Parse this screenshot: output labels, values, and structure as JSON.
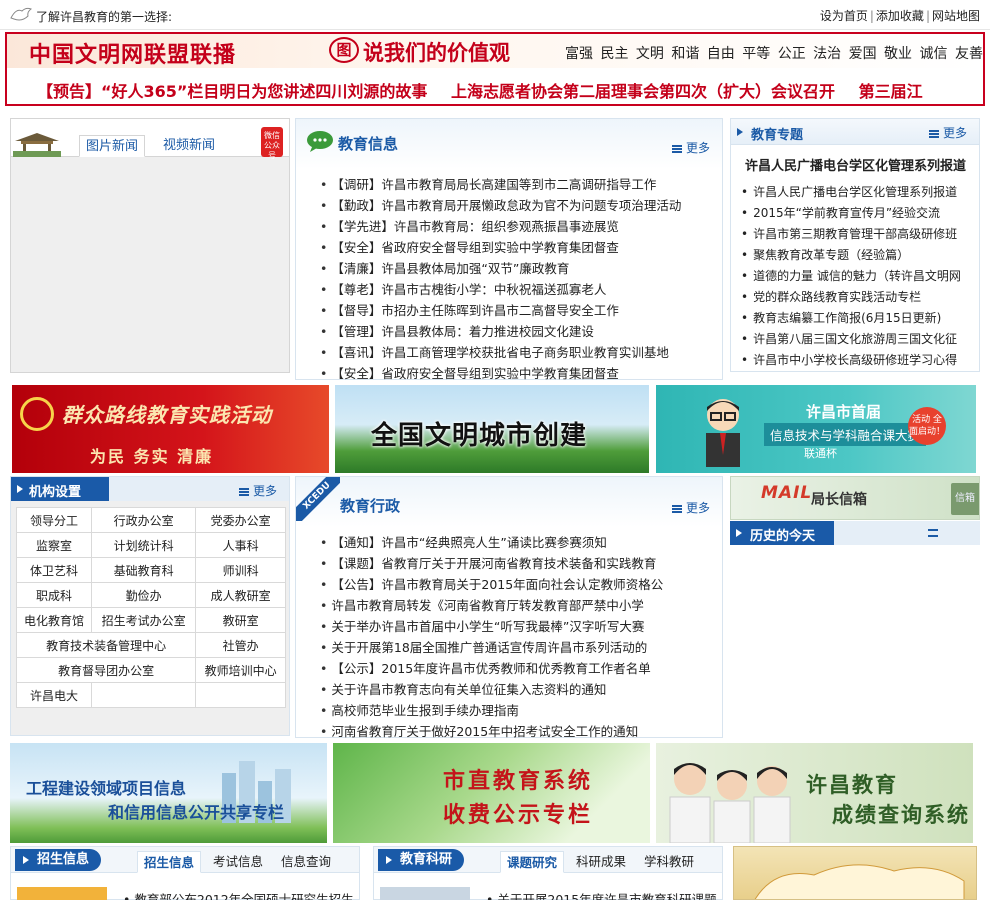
{
  "topbar": {
    "slogan": "了解许昌教育的第一选择:",
    "links": [
      "设为首页",
      "添加收藏",
      "网站地图"
    ]
  },
  "civ_banner": {
    "brand": "中国文明网联盟联播",
    "tu": "图",
    "shuo": "说我们的价值观",
    "values": "富强 民主 文明 和谐 自由 平等 公正 法治 爱国 敬业 诚信 友善",
    "marquee": [
      "【预告】“好人365”栏目明日为您讲述四川刘源的故事",
      "上海志愿者协会第二届理事会第四次（扩大）会议召开",
      "第三届江"
    ]
  },
  "photo_news": {
    "tabs": [
      "图片新闻",
      "视频新闻"
    ],
    "badge": "微信 公众号"
  },
  "edu_info": {
    "title": "教育信息",
    "more": "更多",
    "items": [
      "【调研】许昌市教育局局长高建国等到市二高调研指导工作",
      "【勤政】许昌市教育局开展懒政怠政为官不为问题专项治理活动",
      "【学先进】许昌市教育局：组织参观燕振昌事迹展览",
      "【安全】省政府安全督导组到实验中学教育集团督查",
      "【清廉】许昌县教体局加强“双节”廉政教育",
      "【尊老】许昌市古槐街小学：中秋祝福送孤寡老人",
      "【督导】市招办主任陈晖到许昌市二高督导安全工作",
      "【管理】许昌县教体局：着力推进校园文化建设",
      "【喜讯】许昌工商管理学校获批省电子商务职业教育实训基地",
      "【安全】省政府安全督导组到实验中学教育集团督查"
    ]
  },
  "edu_topic": {
    "title": "教育专题",
    "more": "更多",
    "headline": "许昌人民广播电台学区化管理系列报道",
    "items": [
      "许昌人民广播电台学区化管理系列报道",
      "2015年“学前教育宣传月”经验交流",
      "许昌市第三期教育管理干部高级研修班",
      "聚焦教育改革专题（经验篇）",
      "道德的力量 诚信的魅力（转许昌文明网",
      "党的群众路线教育实践活动专栏",
      "教育志编纂工作简报(6月15日更新)",
      "许昌第八届三国文化旅游周三国文化征",
      "许昌市中小学校长高级研修班学习心得"
    ]
  },
  "banners_row1": {
    "mass_line": {
      "t1": "群众路线教育实践活动",
      "t2": "为民 务实 清廉"
    },
    "civ_city": {
      "t": "全国文明城市创建"
    },
    "contest": {
      "t1": "许昌市首届",
      "t2": "信息技术与学科融合课大赛",
      "t3": "联通杯",
      "bubble": "活动 全面启动！"
    }
  },
  "org": {
    "title": "机构设置",
    "more": "更多",
    "rows": [
      [
        "领导分工",
        "行政办公室",
        "党委办公室"
      ],
      [
        "监察室",
        "计划统计科",
        "人事科"
      ],
      [
        "体卫艺科",
        "基础教育科",
        "师训科"
      ],
      [
        "职成科",
        "勤俭办",
        "成人教研室"
      ],
      [
        "电化教育馆",
        "招生考试办公室",
        "教研室"
      ],
      [
        "教育技术装备管理中心",
        "社管办"
      ],
      [
        "教育督导团办公室",
        "教师培训中心"
      ],
      [
        "许昌电大",
        "",
        ""
      ]
    ]
  },
  "edu_admin": {
    "ribbon": "XCEDU",
    "title": "教育行政",
    "more": "更多",
    "items": [
      "【通知】许昌市“经典照亮人生”诵读比赛参赛须知",
      "【课题】省教育厅关于开展河南省教育技术装备和实践教育",
      "【公告】许昌市教育局关于2015年面向社会认定教师资格公",
      "许昌市教育局转发《河南省教育厅转发教育部严禁中小学",
      "关于举办许昌市首届中小学生“听写我最棒”汉字听写大赛",
      "关于开展第18届全国推广普通话宣传周许昌市系列活动的",
      "【公示】2015年度许昌市优秀教师和优秀教育工作者名单",
      "关于许昌市教育志向有关单位征集入志资料的通知",
      "高校师范毕业生报到手续办理指南",
      "河南省教育厅关于做好2015年中招考试安全工作的通知"
    ]
  },
  "mailbox": {
    "logo": "MAIL",
    "title": "局长信箱",
    "env": "信箱"
  },
  "history": {
    "title": "历史的今天"
  },
  "banners_row2": {
    "project": {
      "t1": "工程建设领域项目信息",
      "t2": "和信用信息公开共享专栏"
    },
    "fee": {
      "t1": "市直教育系统",
      "t2": "收费公示专栏"
    },
    "score": {
      "t1": "许昌教育",
      "t2": "成绩查询系统"
    }
  },
  "admissions": {
    "label": "招生信息",
    "tabs": [
      "招生信息",
      "考试信息",
      "信息查询"
    ],
    "line": "教育部公布2012年全国硕士研究生招生"
  },
  "research": {
    "label": "教育科研",
    "tabs": [
      "课题研究",
      "科研成果",
      "学科教研"
    ],
    "line": "关于开展2015年度许昌市教育科研课题"
  },
  "colors": {
    "brand_red": "#c4001a",
    "link_blue": "#1b5aa6"
  }
}
